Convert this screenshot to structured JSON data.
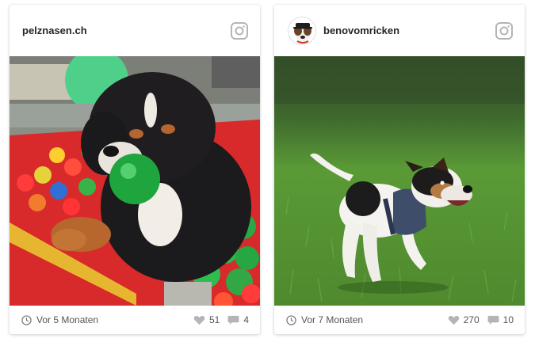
{
  "posts": [
    {
      "username": "pelznasen.ch",
      "time": "Vor 5 Monaten",
      "likes": "51",
      "comments": "4",
      "photo_icon": "puppy-photo"
    },
    {
      "username": "benovomricken",
      "time": "Vor 7 Monaten",
      "likes": "270",
      "comments": "10",
      "photo_icon": "jack-russell-photo"
    }
  ],
  "colors": {
    "icon_gray": "#b5b5b5",
    "text": "#262626",
    "grass": "#4f8a2e"
  }
}
